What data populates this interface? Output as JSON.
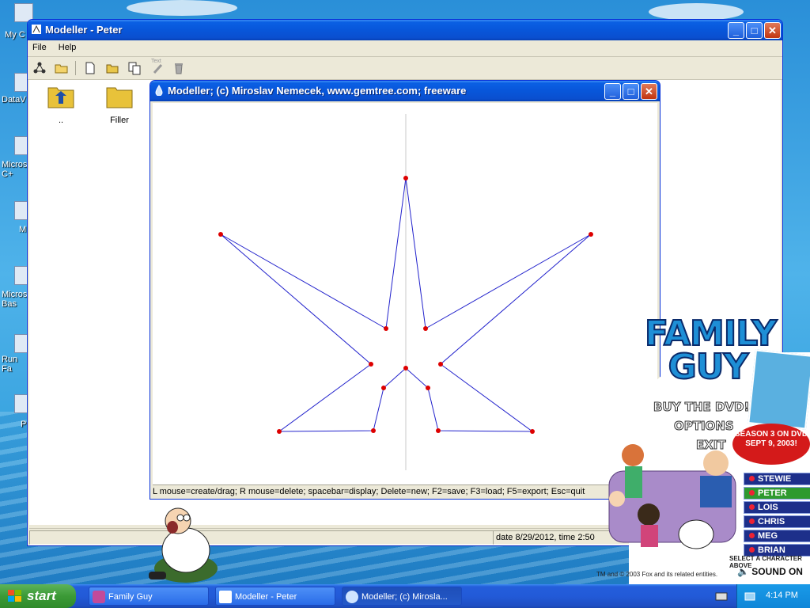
{
  "desktop": {
    "icons": [
      {
        "label": "My C"
      },
      {
        "label": "DataV"
      },
      {
        "label": "Micros\nC+"
      },
      {
        "label": "M"
      },
      {
        "label": "Micros\nBas"
      },
      {
        "label": "Run Fa"
      },
      {
        "label": "P"
      }
    ]
  },
  "main_window": {
    "title": "Modeller - Peter",
    "menu": [
      "File",
      "Help"
    ],
    "folders": [
      {
        "label": ".."
      },
      {
        "label": "Filler"
      }
    ],
    "toolbar_text_label": "Text",
    "status": "date 8/29/2012, time 2:50"
  },
  "editor_window": {
    "title": "Modeller;   (c) Miroslav Nemecek, www.gemtree.com;   freeware",
    "status": "L mouse=create/drag; R mouse=delete; spacebar=display; Delete=new; F2=save; F3=load; F5=export; Esc=quit"
  },
  "family_guy": {
    "title": "FAMILY GUY",
    "menu": [
      "BUY THE DVD!",
      "OPTIONS",
      "EXIT"
    ],
    "season": "SEASON 3 ON DVD SEPT 9, 2003!",
    "characters": [
      {
        "name": "STEWIE",
        "selected": false
      },
      {
        "name": "PETER",
        "selected": true
      },
      {
        "name": "LOIS",
        "selected": false
      },
      {
        "name": "CHRIS",
        "selected": false
      },
      {
        "name": "MEG",
        "selected": false
      },
      {
        "name": "BRIAN",
        "selected": false
      }
    ],
    "select_hint": "SELECT A CHARACTER ABOVE",
    "copyright": "TM and © 2003 Fox and its related entities.",
    "sound": "SOUND ON"
  },
  "taskbar": {
    "start": "start",
    "tasks": [
      "Family Guy",
      "Modeller - Peter",
      "Modeller;   (c) Mirosla..."
    ],
    "clock": "4:14 PM"
  },
  "colors": {
    "xp_blue": "#0a5fe3",
    "line": "#2222cc",
    "vertex": "#dd0000"
  }
}
